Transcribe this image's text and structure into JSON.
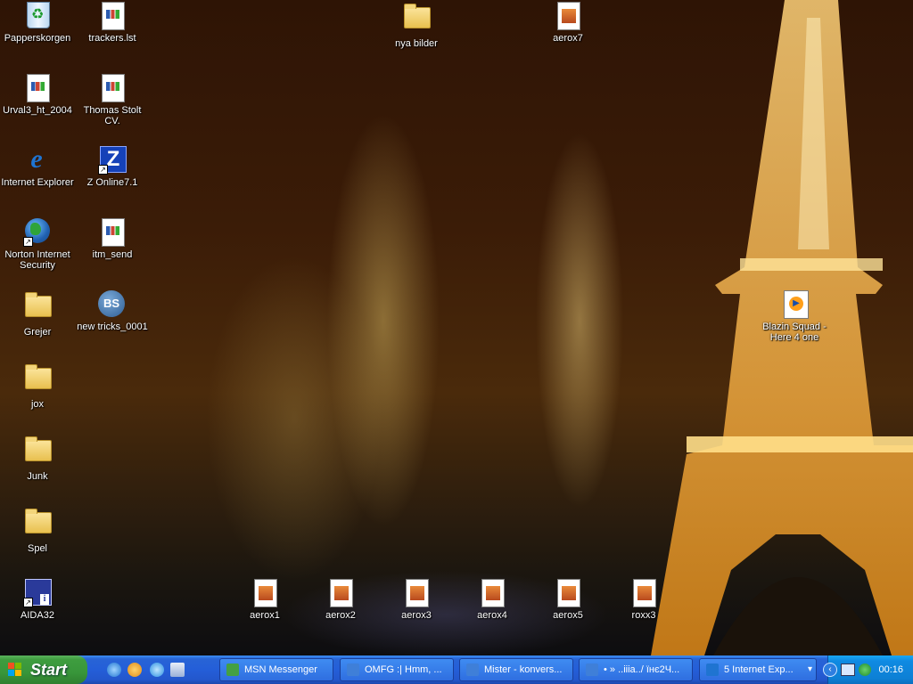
{
  "desktop": {
    "icons": [
      {
        "label": "Papperskorgen",
        "icon": "recycle-bin-icon"
      },
      {
        "label": "trackers.lst",
        "icon": "document-icon"
      },
      {
        "label": "nya bilder",
        "icon": "folder-icon"
      },
      {
        "label": "aerox7",
        "icon": "image-file-icon"
      },
      {
        "label": "Urval3_ht_2004",
        "icon": "document-icon"
      },
      {
        "label": "Thomas Stolt CV.",
        "icon": "word-document-icon"
      },
      {
        "label": "Internet Explorer",
        "icon": "internet-explorer-icon"
      },
      {
        "label": "Z Online7.1",
        "icon": "z-app-shortcut-icon"
      },
      {
        "label": "Norton Internet Security",
        "icon": "norton-globe-icon"
      },
      {
        "label": "itm_send",
        "icon": "document-icon"
      },
      {
        "label": "Grejer",
        "icon": "folder-icon"
      },
      {
        "label": "new tricks_0001",
        "icon": "bs-player-icon"
      },
      {
        "label": "Blazin Squad - Here 4 one",
        "icon": "media-file-icon"
      },
      {
        "label": "jox",
        "icon": "folder-icon"
      },
      {
        "label": "Junk",
        "icon": "folder-icon"
      },
      {
        "label": "Spel",
        "icon": "folder-icon"
      },
      {
        "label": "AIDA32",
        "icon": "aida32-icon"
      },
      {
        "label": "aerox1",
        "icon": "image-file-icon"
      },
      {
        "label": "aerox2",
        "icon": "image-file-icon"
      },
      {
        "label": "aerox3",
        "icon": "image-file-icon"
      },
      {
        "label": "aerox4",
        "icon": "image-file-icon"
      },
      {
        "label": "aerox5",
        "icon": "image-file-icon"
      },
      {
        "label": "roxx3",
        "icon": "image-file-icon"
      }
    ]
  },
  "taskbar": {
    "start_label": "Start",
    "quick_launch": [
      "internet-explorer-icon",
      "media-player-icon",
      "msn-icon",
      "show-desktop-icon"
    ],
    "tasks": [
      {
        "label": "MSN Messenger",
        "icon": "msn-messenger-icon"
      },
      {
        "label": "OMFG :| Hmm, ...",
        "icon": "msn-conversation-icon"
      },
      {
        "label": "Mister - konvers...",
        "icon": "msn-conversation-icon"
      },
      {
        "label": "• » ..iiia../ ïнє2Ч...",
        "icon": "msn-conversation-icon"
      },
      {
        "label": "5 Internet Exp...",
        "icon": "internet-explorer-icon"
      }
    ],
    "clock": "00:16"
  }
}
